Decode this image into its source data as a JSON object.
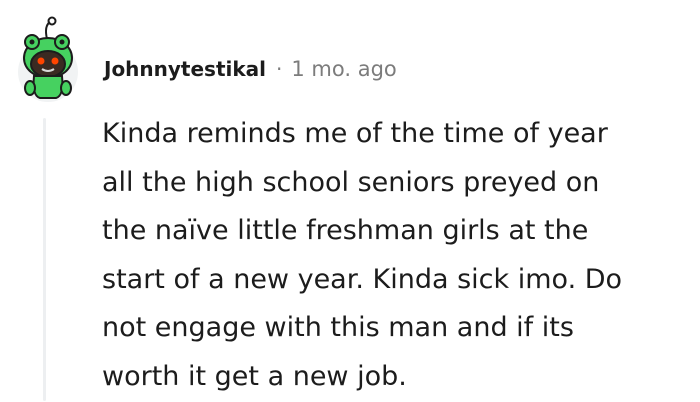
{
  "comment": {
    "author": "Johnnytestikal",
    "separator": "·",
    "timestamp": "1 mo. ago",
    "avatar_icon": "snoo-frog-avatar-icon",
    "body_lines": [
      "Kinda reminds me of the time of year",
      "all the high school seniors preyed on",
      "the naïve little freshman girls at the",
      "start of a new year. Kinda sick imo. Do",
      "not engage with this man and if its",
      "worth it get a new job."
    ]
  },
  "colors": {
    "text": "#1c1c1c",
    "meta": "#7c7c7c",
    "thread_line": "#edeff1",
    "avatar_green": "#46d160",
    "avatar_skin": "#3a2a22"
  }
}
